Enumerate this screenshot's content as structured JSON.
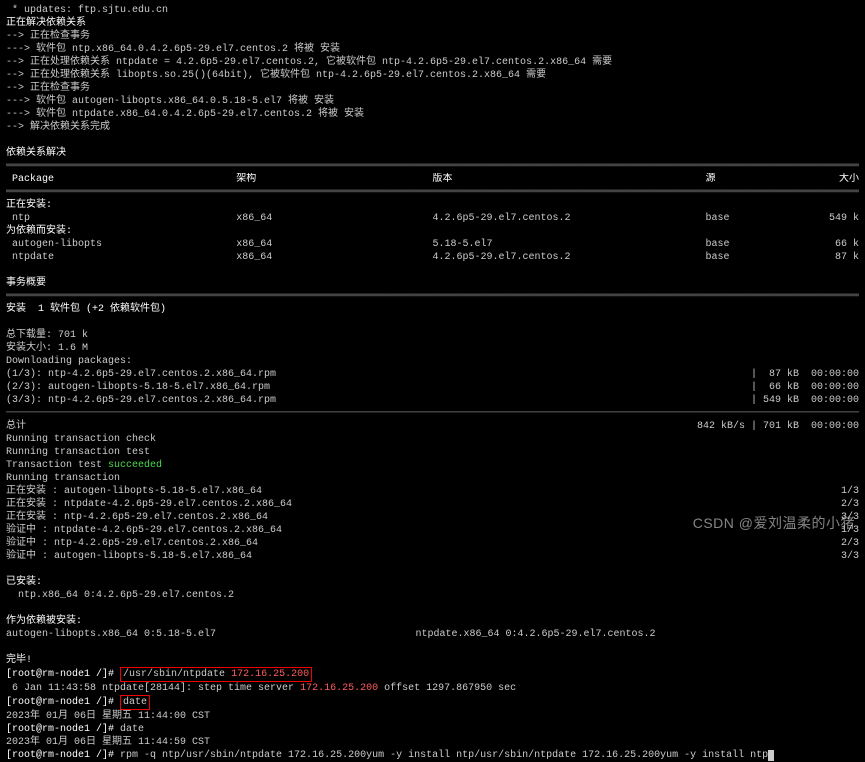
{
  "header": {
    "updates_line": " * updates: ftp.sjtu.edu.cn",
    "resolving_deps": "正在解决依赖关系",
    "checking_trans": "--> 正在检查事务",
    "pkg_ntp": "---> 软件包 ntp.x86_64.0.4.2.6p5-29.el7.centos.2 将被 安装",
    "dep_ntpdate": "--> 正在处理依赖关系 ntpdate = 4.2.6p5-29.el7.centos.2, 它被软件包 ntp-4.2.6p5-29.el7.centos.2.x86_64 需要",
    "dep_libopts": "--> 正在处理依赖关系 libopts.so.25()(64bit), 它被软件包 ntp-4.2.6p5-29.el7.centos.2.x86_64 需要",
    "checking_trans2": "--> 正在检查事务",
    "pkg_autogen": "---> 软件包 autogen-libopts.x86_64.0.5.18-5.el7 将被 安装",
    "pkg_ntpdate": "---> 软件包 ntpdate.x86_64.0.4.2.6p5-29.el7.centos.2 将被 安装",
    "resolving_done": "--> 解决依赖关系完成"
  },
  "dep_solved": "依赖关系解决",
  "table_headers": {
    "pkg": "Package",
    "arch": "架构",
    "ver": "版本",
    "repo": "源",
    "size": "大小"
  },
  "installing_hdr": "正在安装:",
  "rows_install": [
    {
      "pkg": "ntp",
      "arch": "x86_64",
      "ver": "4.2.6p5-29.el7.centos.2",
      "repo": "base",
      "size": "549 k"
    }
  ],
  "deps_hdr": "为依赖而安装:",
  "rows_deps": [
    {
      "pkg": "autogen-libopts",
      "arch": "x86_64",
      "ver": "5.18-5.el7",
      "repo": "base",
      "size": "66 k"
    },
    {
      "pkg": "ntpdate",
      "arch": "x86_64",
      "ver": "4.2.6p5-29.el7.centos.2",
      "repo": "base",
      "size": "87 k"
    }
  ],
  "summary_hdr": "事务概要",
  "install_summary": "安装  1 软件包 (+2 依赖软件包)",
  "totals": {
    "dl_size": "总下载量: 701 k",
    "inst_size": "安装大小: 1.6 M",
    "downloading": "Downloading packages:"
  },
  "downloads": [
    {
      "l": "(1/3): ntp-4.2.6p5-29.el7.centos.2.x86_64.rpm",
      "r": "|  87 kB  00:00:00"
    },
    {
      "l": "(2/3): autogen-libopts-5.18-5.el7.x86_64.rpm",
      "r": "|  66 kB  00:00:00"
    },
    {
      "l": "(3/3): ntp-4.2.6p5-29.el7.centos.2.x86_64.rpm",
      "r": "| 549 kB  00:00:00"
    }
  ],
  "total_line": {
    "l": "总计",
    "r": "842 kB/s | 701 kB  00:00:00"
  },
  "trans": {
    "check": "Running transaction check",
    "test": "Running transaction test",
    "test_ok_pre": "Transaction test ",
    "test_ok": "succeeded",
    "running": "Running transaction"
  },
  "steps": [
    {
      "act": "正在安装",
      "pkg": ": autogen-libopts-5.18-5.el7.x86_64",
      "n": "1/3"
    },
    {
      "act": "正在安装",
      "pkg": ": ntpdate-4.2.6p5-29.el7.centos.2.x86_64",
      "n": "2/3"
    },
    {
      "act": "正在安装",
      "pkg": ": ntp-4.2.6p5-29.el7.centos.2.x86_64",
      "n": "3/3"
    },
    {
      "act": "验证中",
      "pkg": ": ntpdate-4.2.6p5-29.el7.centos.2.x86_64",
      "n": "1/3"
    },
    {
      "act": "验证中",
      "pkg": ": ntp-4.2.6p5-29.el7.centos.2.x86_64",
      "n": "2/3"
    },
    {
      "act": "验证中",
      "pkg": ": autogen-libopts-5.18-5.el7.x86_64",
      "n": "3/3"
    }
  ],
  "installed_hdr": "已安装:",
  "installed_line": "  ntp.x86_64 0:4.2.6p5-29.el7.centos.2",
  "dep_installed_hdr": "作为依赖被安装:",
  "dep_installed_l": "  autogen-libopts.x86_64 0:5.18-5.el7",
  "dep_installed_r": "ntpdate.x86_64 0:4.2.6p5-29.el7.centos.2",
  "complete": "完毕!",
  "cmd1": {
    "prompt": "[root@rm-node1 /]# ",
    "cmd": "/usr/sbin/ntpdate ",
    "ip": "172.16.25.200"
  },
  "ntpdate_out_pre": " 6 Jan 11:43:58 ntpdate[28144]: step time server ",
  "ntpdate_out_ip": "172.16.25.200",
  "ntpdate_out_post": " offset 1297.867950 sec",
  "cmd2": {
    "prompt": "[root@rm-node1 /]# ",
    "cmd": "date"
  },
  "date1": "2023年 01月 06日 星期五 11:44:00 CST",
  "cmd3": {
    "prompt": "[root@rm-node1 /]# ",
    "cmd": "date"
  },
  "date2": "2023年 01月 06日 星期五 11:44:59 CST",
  "cmd4": {
    "prompt": "[root@rm-node1 /]# ",
    "cmd": "rpm -q ntp/usr/sbin/ntpdate 172.16.25.200yum -y install ntp/usr/sbin/ntpdate 172.16.25.200yum -y install ntp"
  },
  "watermark": "CSDN @爱刘温柔的小猪"
}
